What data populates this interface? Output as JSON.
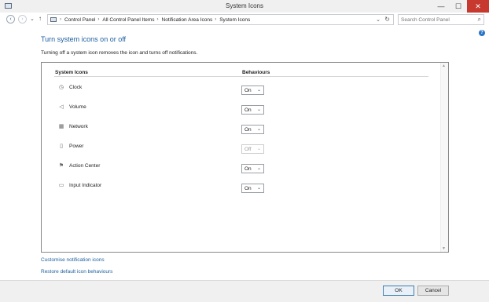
{
  "window": {
    "title": "System Icons"
  },
  "window_controls": {
    "minimize": "—",
    "maximize": "☐",
    "close": "✕"
  },
  "nav": {
    "back": "‹",
    "forward": "›",
    "recent": "⌄",
    "up": "↑",
    "breadcrumb": [
      "Control Panel",
      "All Control Panel Items",
      "Notification Area Icons",
      "System Icons"
    ],
    "breadcrumb_sep": "›",
    "dropdown": "⌄",
    "refresh": "↻"
  },
  "search": {
    "placeholder": "Search Control Panel",
    "icon": "⌕"
  },
  "help": {
    "label": "?"
  },
  "page": {
    "heading": "Turn system icons on or off",
    "description": "Turning off a system icon removes the icon and turns off notifications."
  },
  "table": {
    "headers": {
      "icons": "System Icons",
      "behaviours": "Behaviours"
    },
    "rows": [
      {
        "label": "Clock",
        "icon": "clock-icon",
        "glyph": "◷",
        "value": "On",
        "enabled": true
      },
      {
        "label": "Volume",
        "icon": "volume-icon",
        "glyph": "◁",
        "value": "On",
        "enabled": true
      },
      {
        "label": "Network",
        "icon": "network-icon",
        "glyph": "▦",
        "value": "On",
        "enabled": true
      },
      {
        "label": "Power",
        "icon": "power-icon",
        "glyph": "▯",
        "value": "Off",
        "enabled": false
      },
      {
        "label": "Action Center",
        "icon": "flag-icon",
        "glyph": "⚑",
        "value": "On",
        "enabled": true
      },
      {
        "label": "Input Indicator",
        "icon": "keyboard-icon",
        "glyph": "▭",
        "value": "On",
        "enabled": true
      }
    ],
    "dropdown_arrow": "⌄"
  },
  "scrollbar": {
    "up": "▲",
    "down": "▼"
  },
  "links": {
    "customise": "Customise notification icons",
    "restore": "Restore default icon behaviours"
  },
  "buttons": {
    "ok": "OK",
    "cancel": "Cancel"
  }
}
